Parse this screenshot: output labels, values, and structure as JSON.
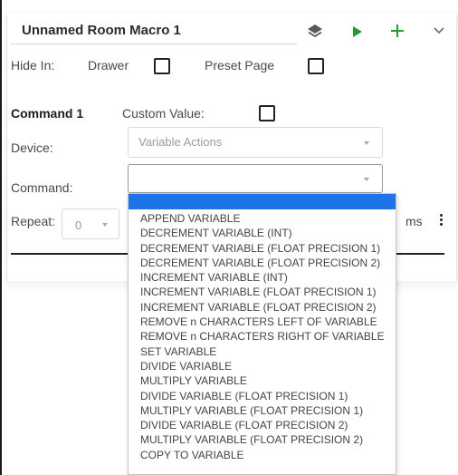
{
  "macro": {
    "title": "Unnamed Room Macro 1",
    "icons": {
      "layers": "layers-icon",
      "play": "play-icon",
      "add": "plus-icon",
      "expand": "chevron-down-icon"
    },
    "colors": {
      "play": "#1e9e2e",
      "add": "#1e9e2e",
      "highlight": "#1e73e8"
    }
  },
  "hide_in": {
    "label": "Hide In:",
    "drawer_label": "Drawer",
    "preset_label": "Preset Page"
  },
  "command": {
    "heading": "Command 1",
    "custom_value_label": "Custom Value:",
    "device_label": "Device:",
    "device_value": "Variable Actions",
    "command_label": "Command:",
    "command_value": "",
    "repeat_label": "Repeat:",
    "repeat_value": "0",
    "ms_label": "ms"
  },
  "command_options": [
    "APPEND VARIABLE",
    "DECREMENT VARIABLE (INT)",
    "DECREMENT VARIABLE (FLOAT PRECISION 1)",
    "DECREMENT VARIABLE (FLOAT PRECISION 2)",
    "INCREMENT VARIABLE (INT)",
    "INCREMENT VARIABLE (FLOAT PRECISION 1)",
    "INCREMENT VARIABLE (FLOAT PRECISION 2)",
    "REMOVE n CHARACTERS LEFT OF VARIABLE",
    "REMOVE n CHARACTERS RIGHT OF VARIABLE",
    "SET VARIABLE",
    "DIVIDE VARIABLE",
    "MULTIPLY VARIABLE",
    "DIVIDE VARIABLE (FLOAT PRECISION 1)",
    "MULTIPLY VARIABLE (FLOAT PRECISION 1)",
    "DIVIDE VARIABLE (FLOAT PRECISION 2)",
    "MULTIPLY VARIABLE (FLOAT PRECISION 2)",
    "COPY TO VARIABLE"
  ]
}
